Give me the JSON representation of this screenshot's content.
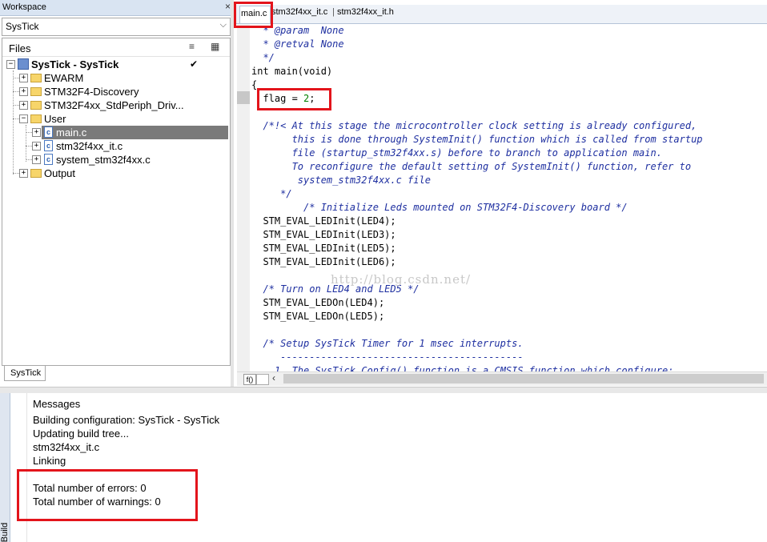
{
  "workspace": {
    "title": "Workspace",
    "close_glyph": "×",
    "config_selected": "SysTick",
    "files_label": "Files",
    "bottom_tab": "SysTick",
    "tree": {
      "project": "SysTick - SysTick",
      "items": [
        {
          "label": "EWARM",
          "type": "folder"
        },
        {
          "label": "STM32F4-Discovery",
          "type": "folder"
        },
        {
          "label": "STM32F4xx_StdPeriph_Driv...",
          "type": "folder"
        },
        {
          "label": "User",
          "type": "folder"
        },
        {
          "label": "main.c",
          "type": "file"
        },
        {
          "label": "stm32f4xx_it.c",
          "type": "file"
        },
        {
          "label": "system_stm32f4xx.c",
          "type": "file"
        },
        {
          "label": "Output",
          "type": "folder"
        }
      ]
    }
  },
  "editor": {
    "tabs": [
      {
        "label": "main.c"
      },
      {
        "label": "stm32f4xx_it.c"
      },
      {
        "label": "stm32f4xx_it.h"
      }
    ],
    "func_button": "f()",
    "code": {
      "l1": "  * @param  None",
      "l2": "  * @retval None",
      "l3": "  */",
      "l4": "int main(void)",
      "l5": "{",
      "l6a": "  flag = ",
      "l6b": "2",
      "l6c": ";",
      "l7": "  /*!< At this stage the microcontroller clock setting is already configured,",
      "l8": "       this is done through SystemInit() function which is called from startup",
      "l9": "       file (startup_stm32f4xx.s) before to branch to application main.",
      "l10": "       To reconfigure the default setting of SystemInit() function, refer to",
      "l11": "        system_stm32f4xx.c file",
      "l12": "     */",
      "l13": "         /* Initialize Leds mounted on STM32F4-Discovery board */",
      "l14": "  STM_EVAL_LEDInit(LED4);",
      "l15": "  STM_EVAL_LEDInit(LED3);",
      "l16": "  STM_EVAL_LEDInit(LED5);",
      "l17": "  STM_EVAL_LEDInit(LED6);",
      "l18": "  /* Turn on LED4 and LED5 */",
      "l19": "  STM_EVAL_LEDOn(LED4);",
      "l20": "  STM_EVAL_LEDOn(LED5);",
      "l21": "  /* Setup SysTick Timer for 1 msec interrupts.",
      "l22": "     ------------------------------------------",
      "l23": "    1. The SysTick_Config() function is a CMSIS function which configure:"
    },
    "watermark": "http://blog.csdn.net/"
  },
  "build": {
    "side_label": "Build",
    "messages": [
      "Messages",
      "Building configuration: SysTick - SysTick",
      "Updating build tree...",
      "stm32f4xx_it.c",
      "Linking",
      "Total number of errors: 0",
      "Total number of warnings: 0"
    ]
  },
  "colors": {
    "annotation_red": "#e3141b",
    "comment_blue": "#1e2fa0",
    "number_green": "#008000",
    "selection_gray": "#7a7a7a"
  }
}
